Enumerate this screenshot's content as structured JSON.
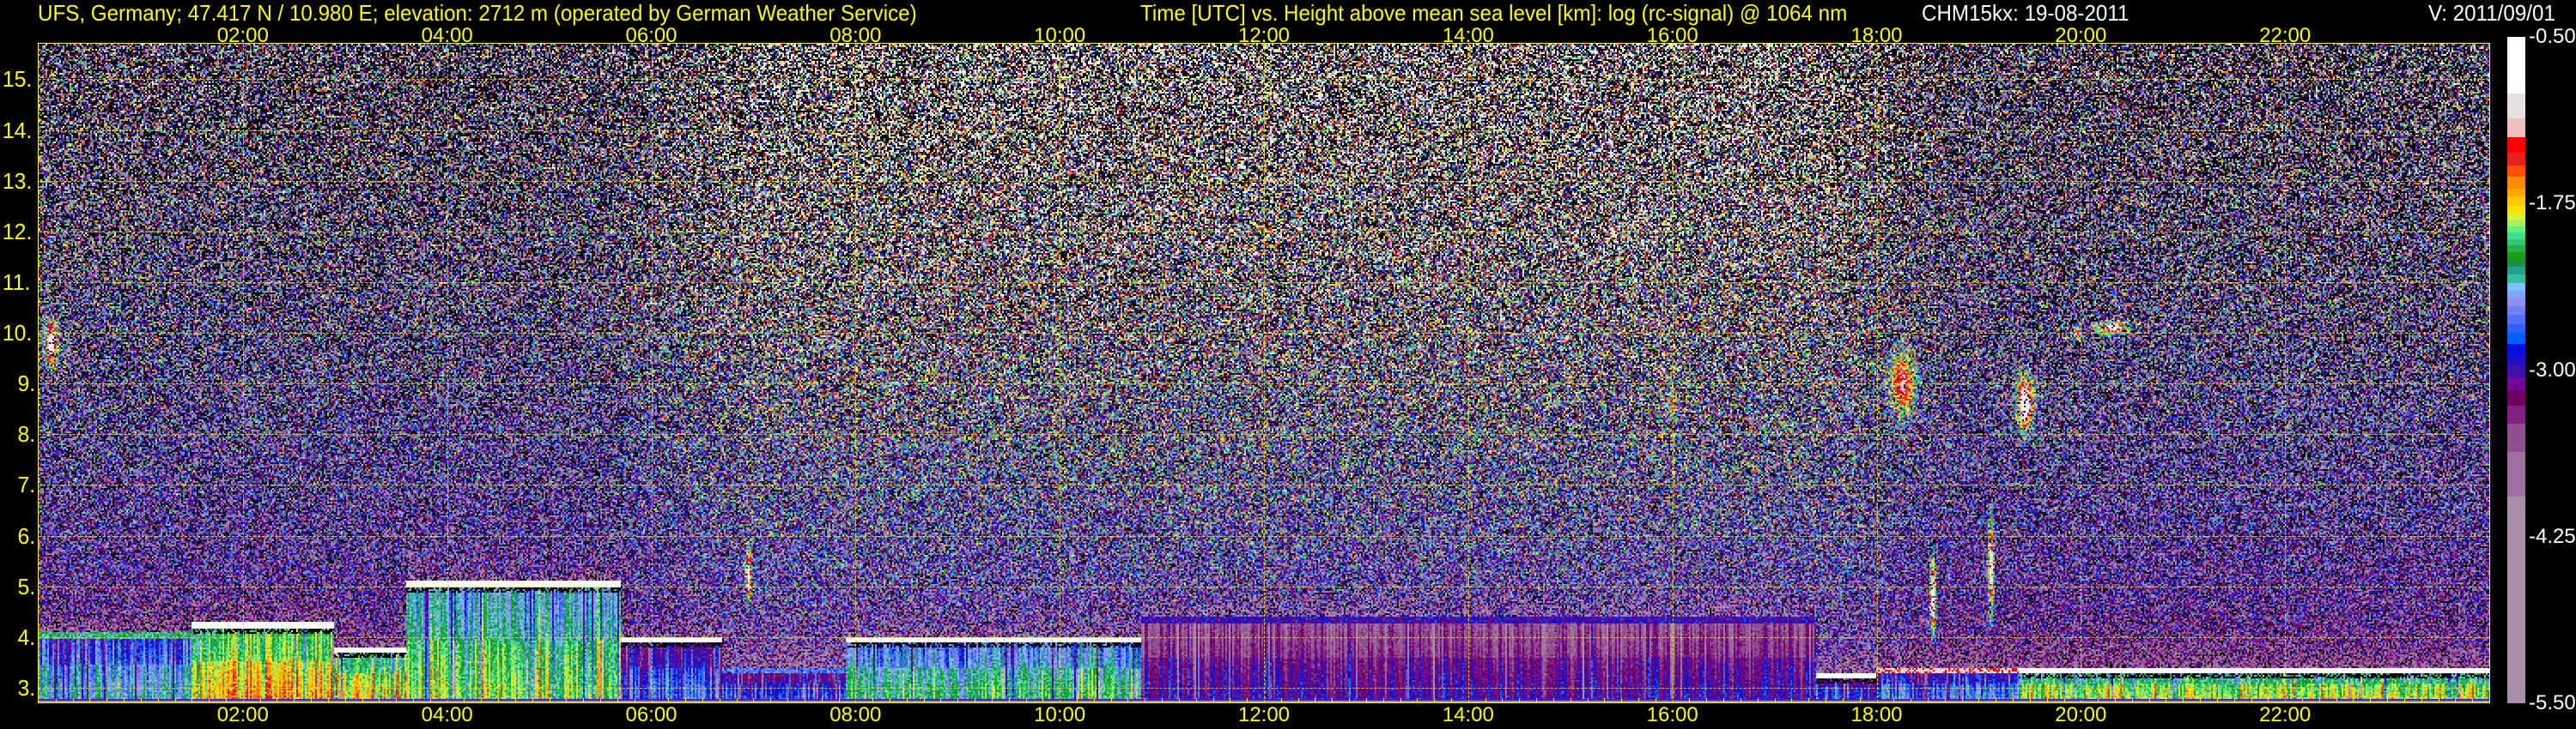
{
  "header": {
    "station": "UFS, Germany; 47.417 N / 10.980 E; elevation: 2712 m  (operated by German Weather Service)",
    "plot_title": "Time [UTC] vs. Height above mean sea level [km]: log (rc-signal) @ 1064 nm",
    "instrument": "CHM15kx: 19-08-2011",
    "version": "V: 2011/09/01"
  },
  "chart_data": {
    "type": "heatmap",
    "title": "Time [UTC] vs. Height above mean sea level [km]: log (rc-signal) @ 1064 nm",
    "xlabel": "Time [UTC]",
    "ylabel": "Height above mean sea level [km]",
    "xlim_hours": [
      0,
      24
    ],
    "ylim_km": [
      2.712,
      15.7
    ],
    "x_ticks": [
      {
        "h": 2,
        "label": "02:00"
      },
      {
        "h": 4,
        "label": "04:00"
      },
      {
        "h": 6,
        "label": "06:00"
      },
      {
        "h": 8,
        "label": "08:00"
      },
      {
        "h": 10,
        "label": "10:00"
      },
      {
        "h": 12,
        "label": "12:00"
      },
      {
        "h": 14,
        "label": "14:00"
      },
      {
        "h": 16,
        "label": "16:00"
      },
      {
        "h": 18,
        "label": "18:00"
      },
      {
        "h": 20,
        "label": "20:00"
      },
      {
        "h": 22,
        "label": "22:00"
      }
    ],
    "y_ticks": [
      {
        "km": 3,
        "label": "3."
      },
      {
        "km": 4,
        "label": "4."
      },
      {
        "km": 5,
        "label": "5."
      },
      {
        "km": 6,
        "label": "6."
      },
      {
        "km": 7,
        "label": "7."
      },
      {
        "km": 8,
        "label": "8."
      },
      {
        "km": 9,
        "label": "9."
      },
      {
        "km": 10,
        "label": "10."
      },
      {
        "km": 11,
        "label": "11."
      },
      {
        "km": 12,
        "label": "12."
      },
      {
        "km": 13,
        "label": "13."
      },
      {
        "km": 14,
        "label": "14."
      },
      {
        "km": 15,
        "label": "15."
      }
    ],
    "grid": true,
    "colorbar": {
      "range": [
        -5.5,
        -0.5
      ],
      "ticks": [
        {
          "v": -0.5,
          "label": "-0.50"
        },
        {
          "v": -1.75,
          "label": "-1.75"
        },
        {
          "v": -3.0,
          "label": "-3.00"
        },
        {
          "v": -4.25,
          "label": "-4.25"
        },
        {
          "v": -5.5,
          "label": "-5.50"
        }
      ],
      "levels": [
        {
          "c": "#ffffff",
          "min": -0.925
        },
        {
          "c": "#e8e0e0",
          "min": -1.112
        },
        {
          "c": "#f0c0c0",
          "min": -1.255
        },
        {
          "c": "#ff0000",
          "min": -1.367
        },
        {
          "c": "#e82020",
          "min": -1.466
        },
        {
          "c": "#ff5000",
          "min": -1.551
        },
        {
          "c": "#ff8c00",
          "min": -1.636
        },
        {
          "c": "#ffa800",
          "min": -1.697
        },
        {
          "c": "#ffc800",
          "min": -1.765
        },
        {
          "c": "#ffe000",
          "min": -1.819
        },
        {
          "c": "#d8f030",
          "min": -1.874
        },
        {
          "c": "#a0f060",
          "min": -1.921
        },
        {
          "c": "#60f080",
          "min": -1.969
        },
        {
          "c": "#40e090",
          "min": -2.017
        },
        {
          "c": "#30c870",
          "min": -2.064
        },
        {
          "c": "#20b050",
          "min": -2.112
        },
        {
          "c": "#18a010",
          "min": -2.173
        },
        {
          "c": "#189040",
          "min": -2.227
        },
        {
          "c": "#20a090",
          "min": -2.281
        },
        {
          "c": "#30c0a0",
          "min": -2.349
        },
        {
          "c": "#80c0f8",
          "min": -2.404
        },
        {
          "c": "#80a8f8",
          "min": -2.458
        },
        {
          "c": "#9090f0",
          "min": -2.519
        },
        {
          "c": "#7080f0",
          "min": -2.587
        },
        {
          "c": "#5070f8",
          "min": -2.655
        },
        {
          "c": "#3060f8",
          "min": -2.723
        },
        {
          "c": "#0060ff",
          "min": -2.804
        },
        {
          "c": "#0010e0",
          "min": -2.893
        },
        {
          "c": "#2010c0",
          "min": -2.974
        },
        {
          "c": "#4010a8",
          "min": -3.063
        },
        {
          "c": "#700898",
          "min": -3.151
        },
        {
          "c": "#700060",
          "min": -3.266
        },
        {
          "c": "#802080",
          "min": -3.402
        },
        {
          "c": "#905090",
          "min": -3.613
        },
        {
          "c": "#a070a0",
          "min": -3.946
        },
        {
          "c": "#a890a8",
          "min": -5.5
        }
      ]
    },
    "aerosol_layers": [
      {
        "t0": 0.0,
        "t1": 1.5,
        "top_km": 4.1,
        "value": -2.5,
        "top_value": -2.2
      },
      {
        "t0": 1.5,
        "t1": 2.9,
        "top_km": 4.3,
        "value": -1.8,
        "top_value": -0.6
      },
      {
        "t0": 2.9,
        "t1": 3.6,
        "top_km": 3.8,
        "value": -1.9,
        "top_value": -0.6
      },
      {
        "t0": 3.6,
        "t1": 5.7,
        "top_km": 5.1,
        "value": -2.1,
        "top_value": -0.6
      },
      {
        "t0": 5.7,
        "t1": 6.7,
        "top_km": 4.0,
        "value": -2.8,
        "top_value": -0.7
      },
      {
        "t0": 6.7,
        "t1": 7.9,
        "top_km": 3.4,
        "value": -2.9,
        "top_value": -2.6
      },
      {
        "t0": 7.9,
        "t1": 10.8,
        "top_km": 4.0,
        "value": -2.3,
        "top_value": -0.8
      },
      {
        "t0": 10.8,
        "t1": 17.4,
        "top_km": 4.4,
        "value": -3.2,
        "top_value": -3.0
      },
      {
        "t0": 17.4,
        "t1": 18.0,
        "top_km": 3.3,
        "value": -2.9,
        "top_value": -0.7
      },
      {
        "t0": 18.0,
        "t1": 19.4,
        "top_km": 3.4,
        "value": -2.7,
        "top_value": -1.2
      },
      {
        "t0": 19.4,
        "t1": 24.0,
        "top_km": 3.4,
        "value": -2.0,
        "top_value": -0.6
      }
    ],
    "cloud_features": [
      {
        "t": 0.12,
        "km": 9.8,
        "dt": 0.1,
        "dkm": 0.6,
        "value": -0.8
      },
      {
        "t": 16.0,
        "km": 8.6,
        "dt": 0.05,
        "dkm": 0.35,
        "value": -1.3
      },
      {
        "t": 18.25,
        "km": 9.0,
        "dt": 0.18,
        "dkm": 0.9,
        "value": -1.2
      },
      {
        "t": 19.45,
        "km": 8.6,
        "dt": 0.12,
        "dkm": 0.8,
        "value": -0.7
      },
      {
        "t": 19.95,
        "km": 10.0,
        "dt": 0.06,
        "dkm": 0.2,
        "value": -1.0
      },
      {
        "t": 20.3,
        "km": 10.1,
        "dt": 0.22,
        "dkm": 0.18,
        "value": -0.8
      },
      {
        "t": 6.95,
        "km": 5.2,
        "dt": 0.04,
        "dkm": 0.7,
        "value": -0.7
      },
      {
        "t": 18.55,
        "km": 4.8,
        "dt": 0.04,
        "dkm": 1.0,
        "value": -0.6
      },
      {
        "t": 19.12,
        "km": 5.4,
        "dt": 0.04,
        "dkm": 1.3,
        "value": -0.7
      }
    ]
  }
}
